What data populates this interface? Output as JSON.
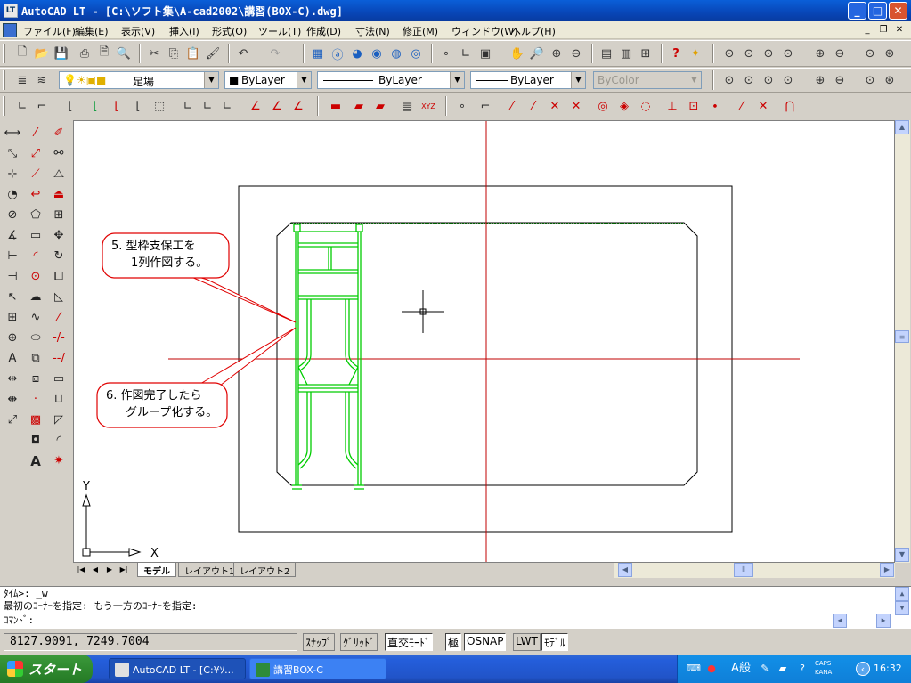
{
  "window": {
    "app_icon_label": "LT",
    "title": "AutoCAD LT - [C:\\ソフト集\\A-cad2002\\講習(BOX-C).dwg]",
    "controls": {
      "minimize": "_",
      "restore": "□",
      "close": "✕"
    }
  },
  "menubar": {
    "items": [
      "ファイル(F)",
      "編集(E)",
      "表示(V)",
      "挿入(I)",
      "形式(O)",
      "ツール(T)",
      "作成(D)",
      "寸法(N)",
      "修正(M)",
      "ウィンドウ(W)",
      "ヘルプ(H)"
    ],
    "doc_controls": {
      "minimize": "_",
      "restore": "❐",
      "close": "✕"
    }
  },
  "toolbar_properties": {
    "layer_name": "足場",
    "color": "ByLayer",
    "linetype": "ByLayer",
    "lineweight": "ByLayer",
    "plotstyle": "ByColor"
  },
  "drawing": {
    "callout1": {
      "line1": "5. 型枠支保工を",
      "line2": "1列作図する。"
    },
    "callout2": {
      "line1": "6. 作図完了したら",
      "line2": "グループ化する。"
    },
    "ucs": {
      "x_label": "X",
      "y_label": "Y"
    }
  },
  "tabs": {
    "items": [
      "モデル",
      "レイアウト1",
      "レイアウト2"
    ],
    "active": "モデル"
  },
  "command_line": {
    "history": [
      "ﾀｲﾑ>:  _w",
      "最初のｺｰﾅｰを指定: もう一方のｺｰﾅｰを指定:"
    ],
    "prompt": "ｺﾏﾝﾄﾞ:"
  },
  "statusbar": {
    "coordinates": "8127.9091,  7249.7004",
    "toggles": [
      "ｽﾅｯﾌﾟ",
      "ｸﾞﾘｯﾄﾞ",
      "直交ﾓｰﾄﾞ",
      "極",
      "OSNAP",
      "LWT",
      "ﾓﾃﾞﾙ"
    ]
  },
  "taskbar": {
    "start_label": "スタート",
    "tasks": [
      "AutoCAD LT - [C:¥ｿ...",
      "講習BOX-C"
    ],
    "ime_label": "A般",
    "caps_label": "CAPS",
    "kana_label": "KANA",
    "clock": "16:32"
  },
  "colors": {
    "titlebar": "#0846b7",
    "crosshair": "#c00000",
    "scaffold": "#00cc00",
    "callout_border": "#e00000"
  }
}
